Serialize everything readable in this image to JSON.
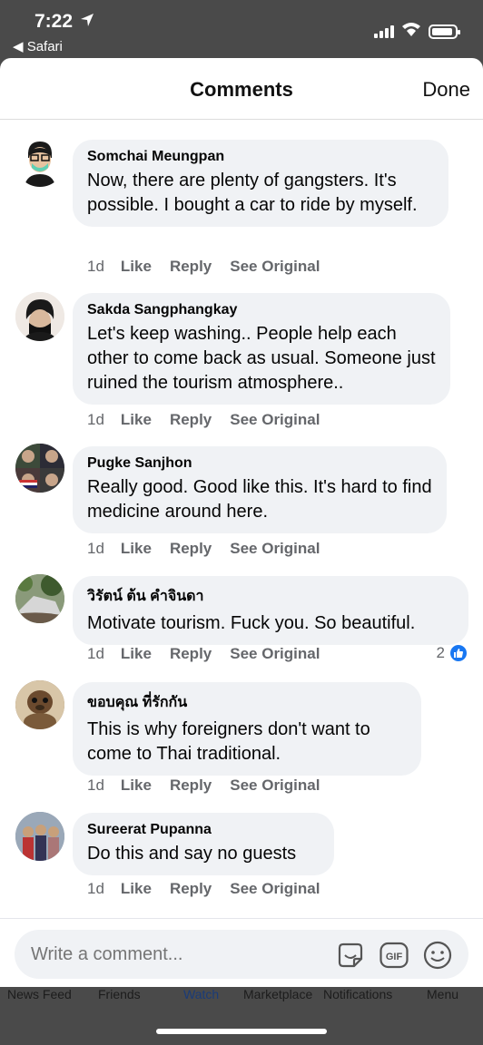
{
  "status": {
    "time": "7:22",
    "back_app": "Safari"
  },
  "header": {
    "title": "Comments",
    "done_label": "Done"
  },
  "comments": [
    {
      "author": "Somchai Meungpan",
      "text": "Now, there are plenty of gangsters. It's possible. I bought a car to ride by myself.",
      "age": "1d",
      "like": "Like",
      "reply": "Reply",
      "see_original": "See Original"
    },
    {
      "author": "Sakda Sangphangkay",
      "text": "Let's keep washing.. People help each other to come back as usual. Someone just ruined the tourism atmosphere..",
      "age": "1d",
      "like": "Like",
      "reply": "Reply",
      "see_original": "See Original"
    },
    {
      "author": "Pugke Sanjhon",
      "text": "Really good. Good like this. It's hard to find medicine around here.",
      "age": "1d",
      "like": "Like",
      "reply": "Reply",
      "see_original": "See Original"
    },
    {
      "author": "วิรัตน์ ต้น คำจินดา",
      "text": "Motivate tourism. Fuck you. So beautiful.",
      "age": "1d",
      "like": "Like",
      "reply": "Reply",
      "see_original": "See Original",
      "reactions": "2"
    },
    {
      "author": "ขอบคุณ ที่รักกัน",
      "text": "This is why foreigners don't want to come to Thai traditional.",
      "age": "1d",
      "like": "Like",
      "reply": "Reply",
      "see_original": "See Original"
    },
    {
      "author": "Sureerat Pupanna",
      "text": "Do this and say no guests",
      "age": "1d",
      "like": "Like",
      "reply": "Reply",
      "see_original": "See Original"
    }
  ],
  "composer": {
    "placeholder": "Write a comment..."
  },
  "tabbar": {
    "news_feed": "News Feed",
    "friends": "Friends",
    "watch": "Watch",
    "marketplace": "Marketplace",
    "notifications": "Notifications",
    "menu": "Menu"
  },
  "colors": {
    "accent": "#1877f2",
    "bubble": "#f0f2f5",
    "meta": "#65676b"
  },
  "icons": [
    "location-arrow-icon",
    "signal-icon",
    "wifi-icon",
    "battery-icon",
    "like-thumb-icon",
    "sticker-icon",
    "gif-icon",
    "emoji-icon"
  ]
}
